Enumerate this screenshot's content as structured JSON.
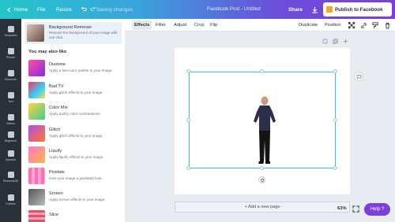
{
  "topbar": {
    "home": "Home",
    "file": "File",
    "resize": "Resize",
    "saving": "Saving changes",
    "title": "Facebook Post - Untitled",
    "share": "Share",
    "publish": "Publish to Facebook"
  },
  "rail": {
    "items": [
      "Templates",
      "Photos",
      "Elements",
      "Text",
      "Videos",
      "Bkground",
      "Uploads",
      "Elements3D",
      "Folders"
    ]
  },
  "panel": {
    "bg_remover": {
      "title": "Background Remover",
      "desc": "Remove the background of your image with one click."
    },
    "also_like": "You may also like",
    "effects": [
      {
        "name": "Duotone",
        "desc": "Apply a two-color palette to your image."
      },
      {
        "name": "Bad TV",
        "desc": "Apply glitch effects to your image."
      },
      {
        "name": "Color Mix",
        "desc": "Apply quirky color combinations."
      },
      {
        "name": "Glitch",
        "desc": "Apply glitch effects to your image."
      },
      {
        "name": "Liquify",
        "desc": "Apply liquify effects to your image."
      },
      {
        "name": "Pixelate",
        "desc": "Give your image a pixelated look."
      },
      {
        "name": "Screen",
        "desc": "Apply screen effects to your image."
      },
      {
        "name": "Slice",
        "desc": ""
      }
    ]
  },
  "toolbar": {
    "effects": "Effects",
    "filter": "Filter",
    "adjust": "Adjust",
    "crop": "Crop",
    "flip": "Flip",
    "duplicate": "Duplicate",
    "position": "Position"
  },
  "canvas": {
    "add_page": "+ Add a new page",
    "zoom": "63%"
  },
  "help": {
    "label": "Help ?"
  },
  "colors": {
    "accent": "#7d3ed9",
    "selection": "#30c7d6",
    "publish_icon": "#f5a623"
  }
}
